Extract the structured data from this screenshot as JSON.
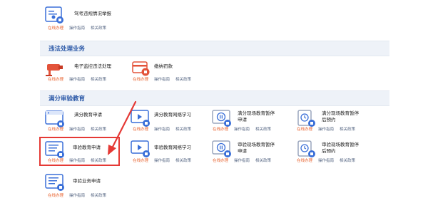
{
  "top": {
    "item": {
      "title": "驾考违规情况举报",
      "links": [
        "在线办理",
        "操作指南",
        "相关政策"
      ]
    }
  },
  "sections": [
    {
      "title": "违法处理业务",
      "items": [
        {
          "title": "电子监控违法处理",
          "links": [
            "在线办理",
            "操作指南",
            "相关政策"
          ]
        },
        {
          "title": "缴纳罚款",
          "links": [
            "在线办理",
            "操作指南",
            "相关政策"
          ]
        }
      ]
    },
    {
      "title": "满分审验教育",
      "rows": [
        [
          {
            "title": "满分教育申请",
            "links": [
              "在线办理",
              "操作指南",
              "相关政策"
            ]
          },
          {
            "title": "满分教育网络学习",
            "links": [
              "在线办理",
              "操作指南",
              "相关政策"
            ]
          },
          {
            "title_l1": "满分现场教育暂停",
            "title_l2": "申请",
            "links": [
              "在线办理",
              "操作指南",
              "相关政策"
            ]
          },
          {
            "title_l1": "满分现场教育暂停",
            "title_l2": "后预约",
            "links": [
              "在线办理",
              "操作指南",
              "相关政策"
            ]
          }
        ],
        [
          {
            "title": "审验教育申请",
            "links": [
              "在线办理",
              "操作指南",
              "相关政策"
            ]
          },
          {
            "title": "审验教育网络学习",
            "links": [
              "在线办理",
              "操作指南",
              "相关政策"
            ]
          },
          {
            "title_l1": "审验现场教育暂停",
            "title_l2": "申请",
            "links": [
              "在线办理",
              "操作指南",
              "相关政策"
            ]
          },
          {
            "title_l1": "审验现场教育暂停",
            "title_l2": "后预约",
            "links": [
              "在线办理",
              "操作指南",
              "相关政策"
            ]
          }
        ],
        [
          {
            "title": "审验业务申请",
            "links": [
              "在线办理",
              "操作指南",
              "相关政策"
            ]
          }
        ]
      ]
    }
  ],
  "colors": {
    "accent": "#2d5aa8",
    "link_online": "#e8632f",
    "highlight": "#e53935",
    "icon_blue": "#3a6fd8"
  }
}
